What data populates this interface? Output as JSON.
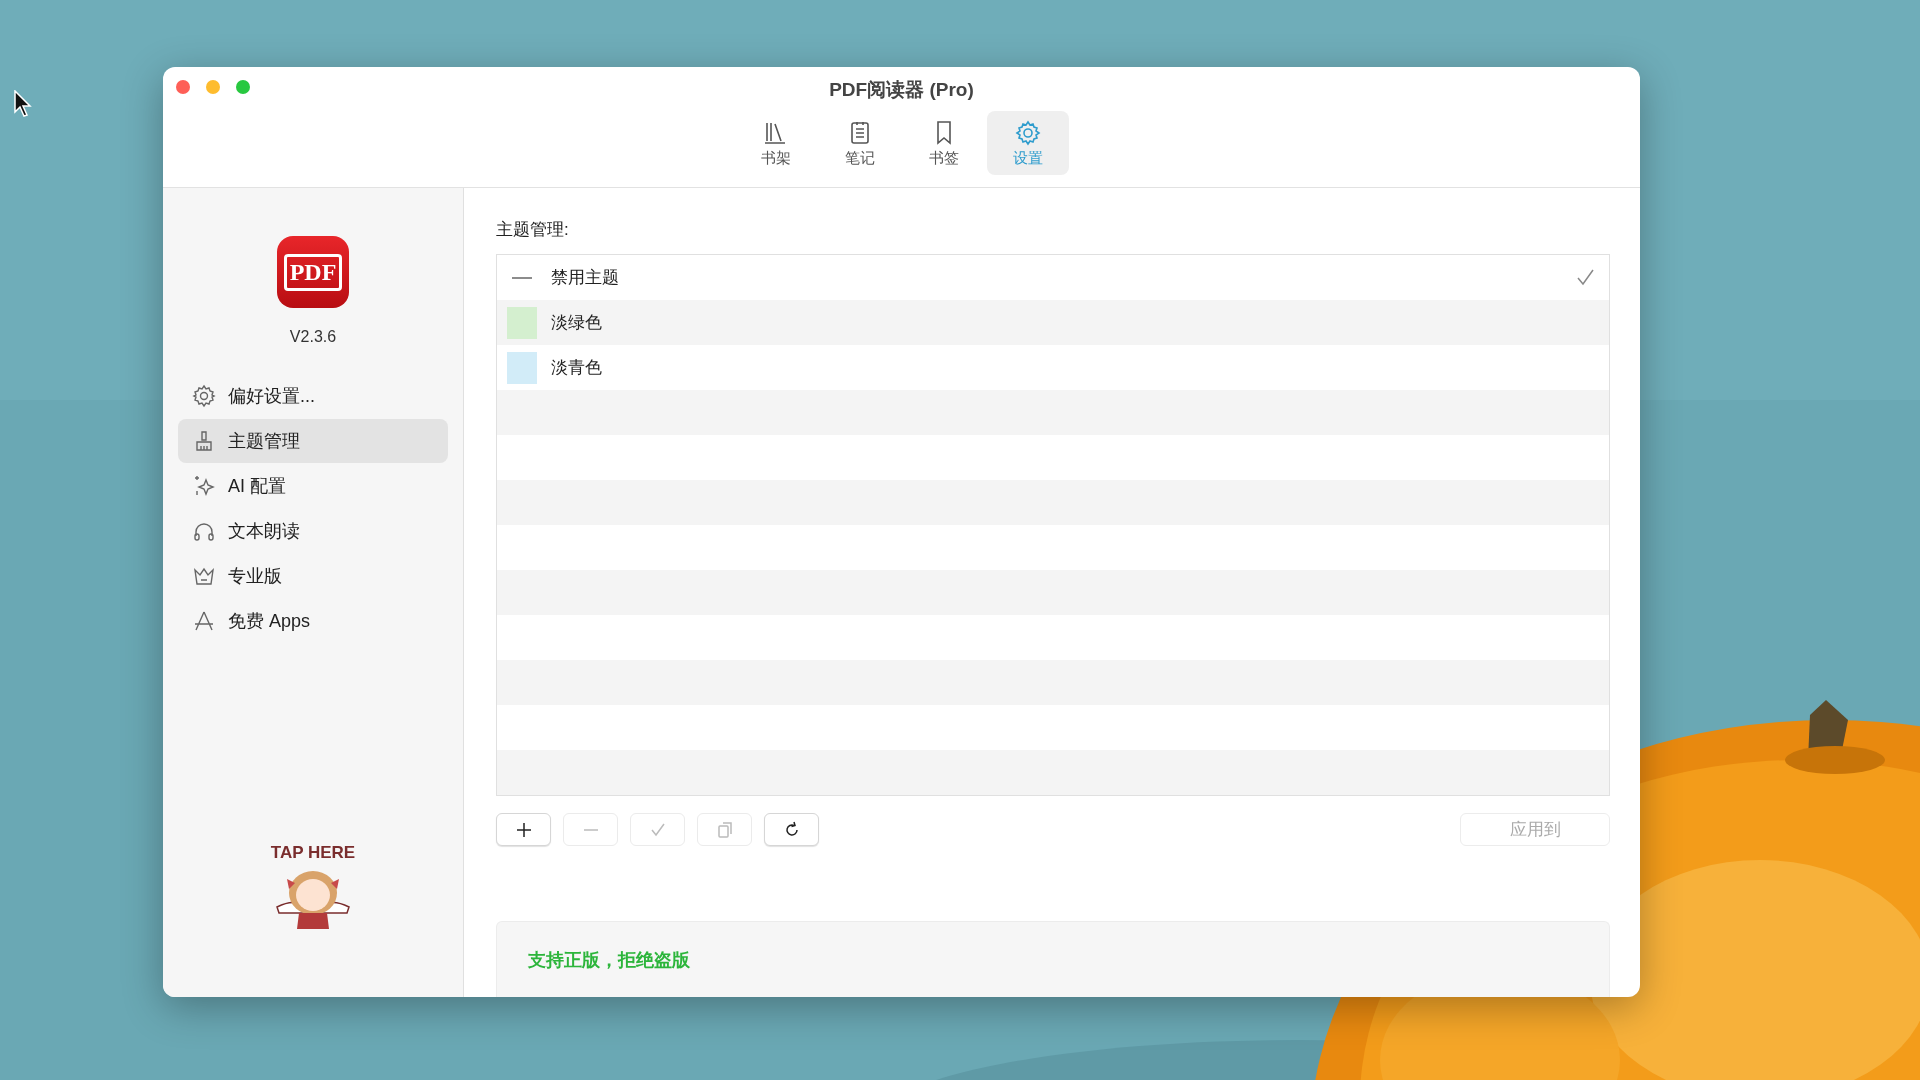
{
  "window": {
    "title": "PDF阅读器 (Pro)"
  },
  "toolbar": {
    "tabs": [
      {
        "label": "书架",
        "selected": false
      },
      {
        "label": "笔记",
        "selected": false
      },
      {
        "label": "书签",
        "selected": false
      },
      {
        "label": "设置",
        "selected": true
      }
    ]
  },
  "sidebar": {
    "logo": "PDF",
    "version": "V2.3.6",
    "items": [
      {
        "label": "偏好设置...",
        "selected": false
      },
      {
        "label": "主题管理",
        "selected": true
      },
      {
        "label": "AI 配置",
        "selected": false
      },
      {
        "label": "文本朗读",
        "selected": false
      },
      {
        "label": "专业版",
        "selected": false
      },
      {
        "label": "免费 Apps",
        "selected": false
      }
    ],
    "sticker": "TAP HERE"
  },
  "themes": {
    "heading": "主题管理:",
    "rows": [
      {
        "kind": "none",
        "label": "禁用主题",
        "selected": true
      },
      {
        "kind": "swatch",
        "label": "淡绿色",
        "color": "#d4efcf",
        "selected": false
      },
      {
        "kind": "swatch",
        "label": "淡青色",
        "color": "#d2ecf8",
        "selected": false
      }
    ],
    "buttons": [
      {
        "kind": "add",
        "disabled": false
      },
      {
        "kind": "remove",
        "disabled": true
      },
      {
        "kind": "check",
        "disabled": true
      },
      {
        "kind": "copy",
        "disabled": true
      },
      {
        "kind": "refresh",
        "disabled": false
      }
    ],
    "apply_button": {
      "label": "应用到",
      "disabled": true
    }
  },
  "footer": {
    "notice": "支持正版，拒绝盗版"
  }
}
